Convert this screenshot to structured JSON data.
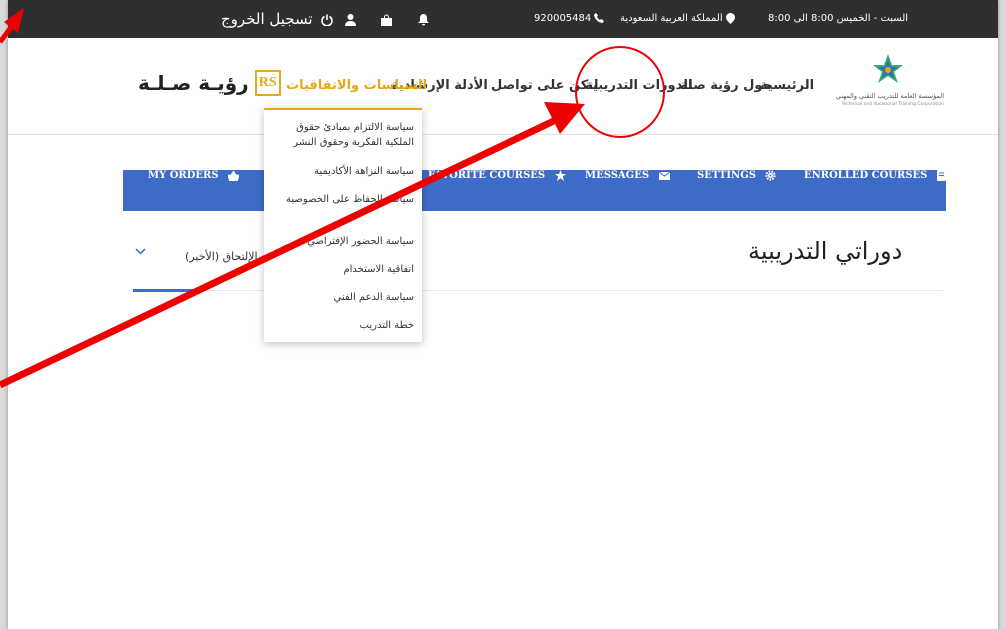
{
  "topbar": {
    "hours": "السبت - الخميس 8:00 الى 8:00",
    "location": "المملكة العربية السعودية",
    "phone": "920005484",
    "logout_label": "تسجيل الخروج",
    "icons": [
      "bell-icon",
      "bag-icon",
      "user-icon",
      "power-icon",
      "pin-icon",
      "phone-icon"
    ]
  },
  "header": {
    "org_name_ar": "المؤسسة العامة للتدريب التقني والمهني",
    "org_name_en": "Technical and Vocational Training Corporation",
    "brand_mark": "RS",
    "brand_name": "رؤيـة صـلـة",
    "nav": [
      {
        "label": "الرئيسية"
      },
      {
        "label": "حول رؤية صلة"
      },
      {
        "label": "الدورات التدريبية"
      },
      {
        "label": "لنكن على تواصل"
      },
      {
        "label": "الأدلة الإرشادية"
      },
      {
        "label": "السياسات والاتفاقيات",
        "active": true
      }
    ]
  },
  "dropdown": {
    "items": [
      "سياسة الالتزام بمبادئ حقوق الملكية الفكرية وحقوق النشر",
      "سياسة النزاهة الأكاديمية",
      "سياسة الحفاظ على الخصوصية",
      "سياسة الحضور الإفتراضي",
      "اتفاقية الاستخدام",
      "سياسة الدعم الفني",
      "خطة التدريب"
    ]
  },
  "tabs": {
    "my_orders": "MY ORDERS",
    "favorite_courses": "FAVORITE COURSES",
    "messages": "MESSAGES",
    "settings": "SETTINGS",
    "enrolled_courses": "ENROLLED COURSES"
  },
  "main": {
    "title": "دوراتي التدريبية",
    "sort_value": "تاريخ الإلتحاق (الأخير)"
  },
  "colors": {
    "topbar": "#2f2f2f",
    "accent": "#e6a817",
    "tab_bar": "#3f6bc8",
    "annotation": "#ee0000"
  }
}
